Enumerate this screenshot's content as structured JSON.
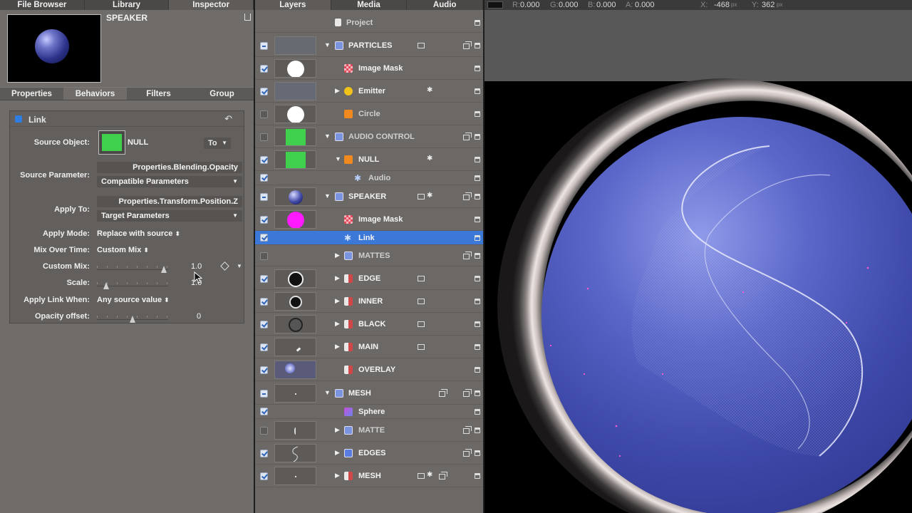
{
  "left_panel": {
    "tabs": [
      "File Browser",
      "Library",
      "Inspector"
    ],
    "object_title": "SPEAKER",
    "sub_tabs": [
      "Properties",
      "Behaviors",
      "Filters",
      "Group"
    ],
    "behavior": {
      "name": "Link",
      "source_object_label": "Source Object:",
      "source_object_value": "NULL",
      "to_label": "To",
      "source_parameter_label": "Source Parameter:",
      "source_parameter_value": "Properties.Blending.Opacity",
      "source_parameter_popup": "Compatible Parameters",
      "apply_to_label": "Apply To:",
      "apply_to_value": "Properties.Transform.Position.Z",
      "apply_to_popup": "Target Parameters",
      "apply_mode_label": "Apply Mode:",
      "apply_mode_value": "Replace with source",
      "mix_over_time_label": "Mix Over Time:",
      "mix_over_time_value": "Custom Mix",
      "custom_mix_label": "Custom Mix:",
      "custom_mix_value": "1.0",
      "scale_label": "Scale:",
      "scale_value": "1.0",
      "apply_link_when_label": "Apply Link When:",
      "apply_link_when_value": "Any source value",
      "opacity_offset_label": "Opacity offset:",
      "opacity_offset_value": "0"
    }
  },
  "layers_panel": {
    "tabs": [
      "Layers",
      "Media",
      "Audio"
    ],
    "rows": [
      {
        "name": "Project",
        "dim": true
      },
      {
        "name": "PARTICLES"
      },
      {
        "name": "Image Mask"
      },
      {
        "name": "Emitter"
      },
      {
        "name": "Circle",
        "dim": true
      },
      {
        "name": "AUDIO CONTROL",
        "dim": true
      },
      {
        "name": "NULL"
      },
      {
        "name": "Audio",
        "dim": true
      },
      {
        "name": "SPEAKER"
      },
      {
        "name": "Image Mask"
      },
      {
        "name": "Link"
      },
      {
        "name": "MATTES",
        "dim": true
      },
      {
        "name": "EDGE"
      },
      {
        "name": "INNER"
      },
      {
        "name": "BLACK"
      },
      {
        "name": "MAIN"
      },
      {
        "name": "OVERLAY"
      },
      {
        "name": "MESH"
      },
      {
        "name": "Sphere"
      },
      {
        "name": "MATTE",
        "dim": true
      },
      {
        "name": "EDGES"
      },
      {
        "name": "MESH"
      }
    ]
  },
  "canvas": {
    "r_label": "R:",
    "r_value": "0.000",
    "g_label": "G:",
    "g_value": "0.000",
    "b_label": "B:",
    "b_value": "0.000",
    "a_label": "A:",
    "a_value": "0.000",
    "x_label": "X:",
    "x_value": "-468",
    "y_label": "Y:",
    "y_value": "362",
    "unit": "px"
  },
  "colors": {
    "accent": "#3c78d8",
    "swatch": "#3fd14e",
    "magenta": "#ff1aff"
  }
}
